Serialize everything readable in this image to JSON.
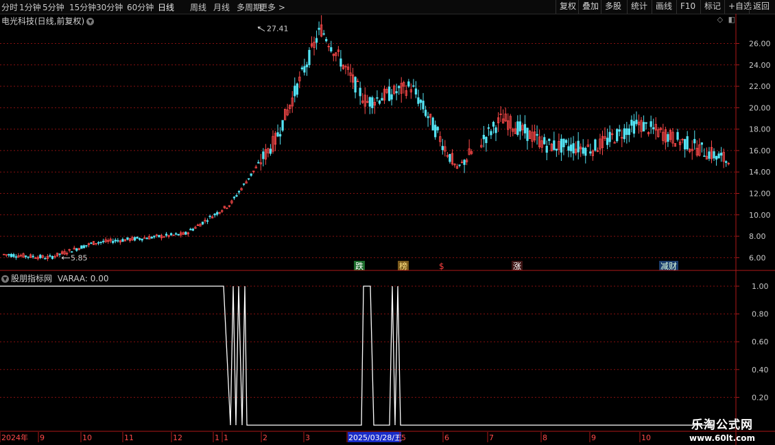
{
  "toolbar": {
    "periods": [
      "分时",
      "1分钟",
      "5分钟",
      "15分钟",
      "30分钟",
      "60分钟",
      "日线",
      "周线",
      "月线",
      "多周期",
      "更多 >"
    ],
    "active_period": "日线",
    "right_buttons": [
      "复权",
      "叠加",
      "多股",
      "统计",
      "画线",
      "F10",
      "标记",
      "+自选",
      "返回"
    ]
  },
  "stock": {
    "title": "电光科技(日线,前复权)"
  },
  "price_axis": {
    "labels": [
      "26.00",
      "24.00",
      "22.00",
      "20.00",
      "18.00",
      "16.00",
      "14.00",
      "12.00",
      "10.00",
      "8.00",
      "6.00"
    ]
  },
  "annotations": {
    "high_label": "27.41",
    "low_label": "5.85",
    "event_tags": [
      "跌",
      "榜",
      "$",
      "涨",
      "减财"
    ]
  },
  "indicator": {
    "name": "股朋指标网",
    "readout": "VARAA: 0.00",
    "axis_labels": [
      "1.00",
      "0.80",
      "0.60",
      "0.40",
      "0.20"
    ]
  },
  "time_axis": {
    "labels": [
      "2024年",
      "9",
      "10",
      "11",
      "12",
      "1",
      "1",
      "2",
      "3",
      "2025/03/28/五",
      "5",
      "6",
      "7",
      "8",
      "9",
      "10"
    ]
  },
  "watermark": {
    "line1": "乐淘公式网",
    "line2": "www.60lt.com"
  },
  "colors": {
    "up": "#ff4a4a",
    "down": "#54e4f4",
    "grid": "#8a1010",
    "axis": "#b01818"
  },
  "chart_data": {
    "type": "candlestick",
    "title": "电光科技(日线,前复权)",
    "ylim": [
      5,
      27.5
    ],
    "annotated_high": 27.41,
    "annotated_low": 5.85,
    "close_path": [
      {
        "x": "2024-08",
        "y": 6.3
      },
      {
        "x": "2024-09",
        "y": 6.0
      },
      {
        "x": "2024-10",
        "y": 7.4
      },
      {
        "x": "2024-11",
        "y": 7.8
      },
      {
        "x": "2024-12",
        "y": 8.2
      },
      {
        "x": "2025-01",
        "y": 11.0
      },
      {
        "x": "2025-01b",
        "y": 17.0
      },
      {
        "x": "2025-02",
        "y": 27.4
      },
      {
        "x": "2025-02b",
        "y": 20.5
      },
      {
        "x": "2025-03",
        "y": 22.0
      },
      {
        "x": "2025-04",
        "y": 14.3
      },
      {
        "x": "2025-05",
        "y": 19.0
      },
      {
        "x": "2025-06",
        "y": 16.5
      },
      {
        "x": "2025-07",
        "y": 16.2
      },
      {
        "x": "2025-08",
        "y": 18.5
      },
      {
        "x": "2025-09",
        "y": 16.8
      },
      {
        "x": "2025-10",
        "y": 15.0
      }
    ],
    "indicator_series": {
      "name": "VARAA",
      "ylim": [
        0,
        1
      ],
      "values": [
        1,
        1,
        1,
        1,
        1,
        0,
        1,
        0,
        1,
        0,
        1,
        0,
        0,
        0,
        0,
        0,
        1,
        1,
        0,
        0,
        1,
        0,
        1,
        0,
        0,
        0,
        0,
        0,
        0,
        0,
        0,
        0
      ]
    }
  }
}
